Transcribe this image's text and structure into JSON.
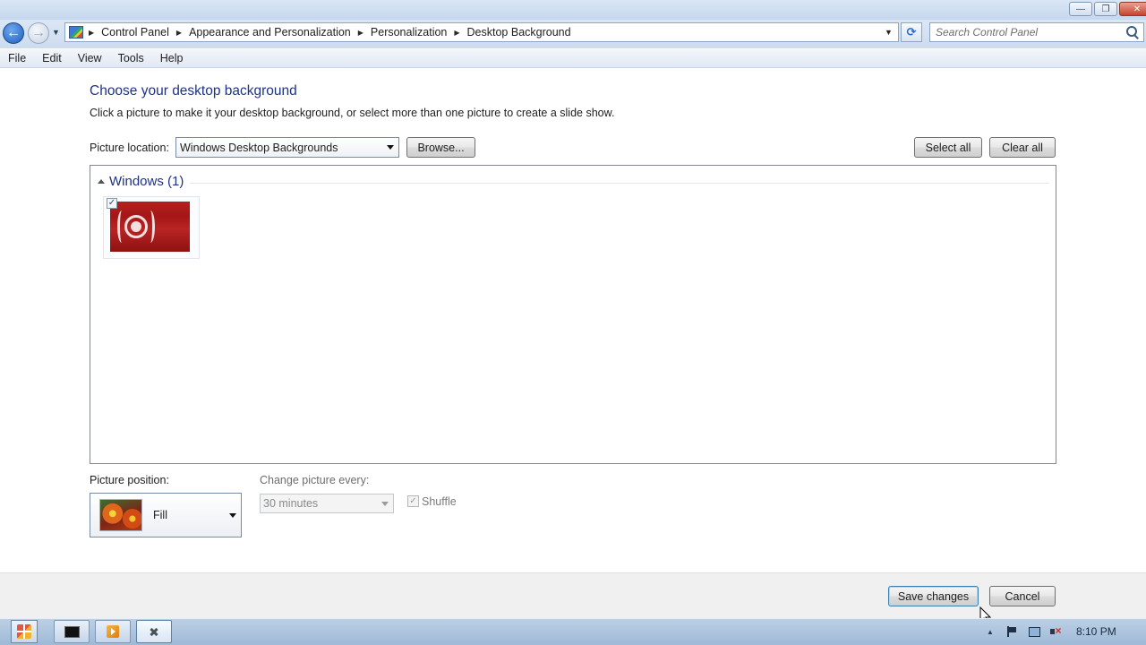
{
  "window": {
    "minimize_glyph": "—",
    "maximize_glyph": "❐",
    "close_glyph": "✕"
  },
  "navigation": {
    "back_glyph": "←",
    "forward_glyph": "→",
    "recent_glyph": "▼",
    "breadcrumbs": [
      "Control Panel",
      "Appearance and Personalization",
      "Personalization",
      "Desktop Background"
    ],
    "refresh_glyph": "⟳",
    "search_placeholder": "Search Control Panel"
  },
  "menu": [
    "File",
    "Edit",
    "View",
    "Tools",
    "Help"
  ],
  "main": {
    "title": "Choose your desktop background",
    "description": "Click a picture to make it your desktop background, or select more than one picture to create a slide show.",
    "picture_location_label": "Picture location:",
    "picture_location_value": "Windows Desktop Backgrounds",
    "browse_label": "Browse...",
    "select_all_label": "Select all",
    "clear_all_label": "Clear all",
    "group_header": "Windows (1)",
    "thumbnail_checked_glyph": "✓",
    "picture_position_label": "Picture position:",
    "picture_position_value": "Fill",
    "change_picture_label": "Change picture every:",
    "change_picture_value": "30 minutes",
    "shuffle_label": "Shuffle",
    "shuffle_checked_glyph": "✓"
  },
  "footer": {
    "save_label": "Save changes",
    "cancel_label": "Cancel"
  },
  "taskbar": {
    "tray_expand_glyph": "▲",
    "clock": "8:10 PM"
  },
  "colors": {
    "heading": "#1e3287",
    "thumbnail": "#b52020",
    "taskbar": "#a9c0dc"
  },
  "icons": {
    "address": "control-panel-icon",
    "search": "search-icon",
    "start": "windows-logo-icon",
    "task_1": "command-prompt-icon",
    "task_2": "media-player-icon",
    "task_3": "control-panel-tools-icon",
    "tray_1": "action-center-flag-icon",
    "tray_2": "network-icon",
    "tray_3": "volume-muted-icon"
  }
}
